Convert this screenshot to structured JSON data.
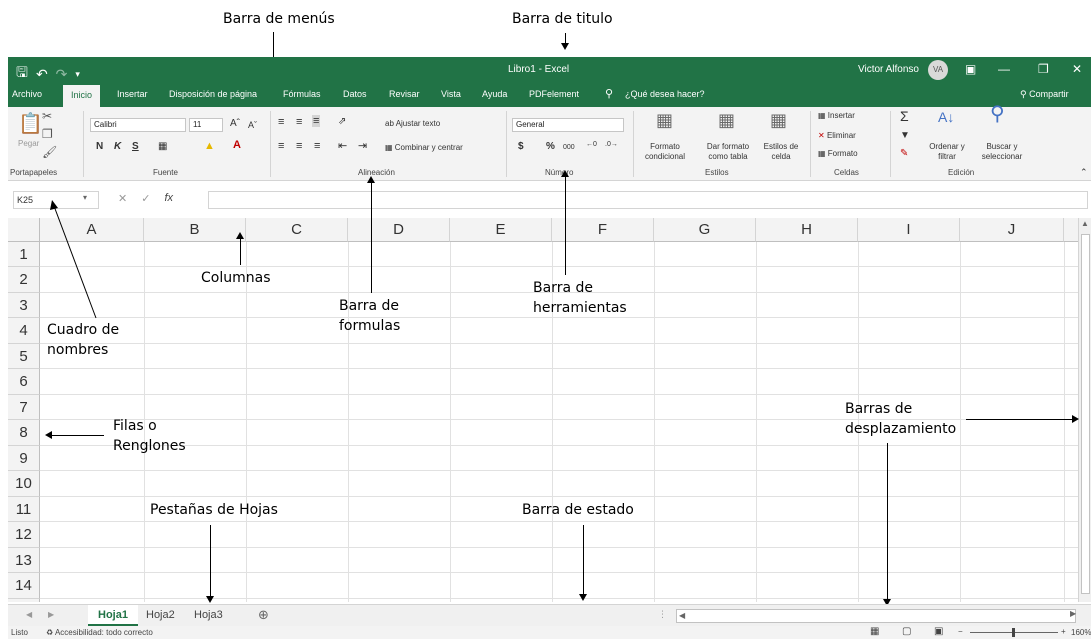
{
  "annotations": {
    "menu_bar": "Barra de menús",
    "title_bar": "Barra de titulo",
    "columns": "Columnas",
    "formula_bar_1": "Barra de",
    "formula_bar_2": "formulas",
    "toolbar_1": "Barra de",
    "toolbar_2": "herramientas",
    "name_box_1": "Cuadro de",
    "name_box_2": "nombres",
    "rows_1": "Filas o",
    "rows_2": "Renglones",
    "scrollbars_1": "Barras de",
    "scrollbars_2": "desplazamiento",
    "sheet_tabs": "Pestañas de Hojas",
    "status_bar": "Barra de estado"
  },
  "window": {
    "title": "Libro1 - Excel",
    "user": "Victor Alfonso",
    "avatar": "VA",
    "accent": "#217346"
  },
  "tabs": [
    "Archivo",
    "Inicio",
    "Insertar",
    "Disposición de página",
    "Fórmulas",
    "Datos",
    "Revisar",
    "Vista",
    "Ayuda",
    "PDFelement"
  ],
  "tell_me": "¿Qué desea hacer?",
  "share": "Compartir",
  "ribbon": {
    "paste": "Pegar",
    "font_name": "Calibri",
    "font_size": "11",
    "bold": "N",
    "italic": "K",
    "underline": "S",
    "wrap_text": "Ajustar texto",
    "merge_center": "Combinar y centrar",
    "number_format": "General",
    "percent": "%",
    "thousands": "000",
    "cond_format_1": "Formato",
    "cond_format_2": "condicional",
    "table_format_1": "Dar formato",
    "table_format_2": "como tabla",
    "cell_styles_1": "Estilos de",
    "cell_styles_2": "celda",
    "insert": "Insertar",
    "delete": "Eliminar",
    "format": "Formato",
    "sort_1": "Ordenar y",
    "sort_2": "filtrar",
    "find_1": "Buscar y",
    "find_2": "seleccionar",
    "groups": {
      "clipboard": "Portapapeles",
      "font": "Fuente",
      "alignment": "Alineación",
      "number": "Número",
      "styles": "Estilos",
      "cells": "Celdas",
      "editing": "Edición"
    }
  },
  "name_box": "K25",
  "columns": [
    "A",
    "B",
    "C",
    "D",
    "E",
    "F",
    "G",
    "H",
    "I",
    "J"
  ],
  "rows": [
    "1",
    "2",
    "3",
    "4",
    "5",
    "6",
    "7",
    "8",
    "9",
    "10",
    "11",
    "12",
    "13",
    "14"
  ],
  "sheets": [
    "Hoja1",
    "Hoja2",
    "Hoja3"
  ],
  "status": {
    "ready": "Listo",
    "accessibility": "Accesibilidad: todo correcto",
    "zoom": "160%"
  }
}
